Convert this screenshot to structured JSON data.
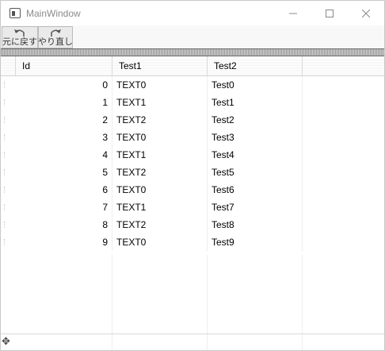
{
  "window": {
    "title": "MainWindow"
  },
  "toolbar": {
    "undo_label": "元に戻す",
    "redo_label": "やり直し"
  },
  "grid": {
    "columns": [
      "Id",
      "Test1",
      "Test2"
    ],
    "rows": [
      {
        "id": "0",
        "test1": "TEXT0",
        "test2": "Test0"
      },
      {
        "id": "1",
        "test1": "TEXT1",
        "test2": "Test1"
      },
      {
        "id": "2",
        "test1": "TEXT2",
        "test2": "Test2"
      },
      {
        "id": "3",
        "test1": "TEXT0",
        "test2": "Test3"
      },
      {
        "id": "4",
        "test1": "TEXT1",
        "test2": "Test4"
      },
      {
        "id": "5",
        "test1": "TEXT2",
        "test2": "Test5"
      },
      {
        "id": "6",
        "test1": "TEXT0",
        "test2": "Test6"
      },
      {
        "id": "7",
        "test1": "TEXT1",
        "test2": "Test7"
      },
      {
        "id": "8",
        "test1": "TEXT2",
        "test2": "Test8"
      },
      {
        "id": "9",
        "test1": "TEXT0",
        "test2": "Test9"
      }
    ],
    "new_row_marker": "✥"
  }
}
